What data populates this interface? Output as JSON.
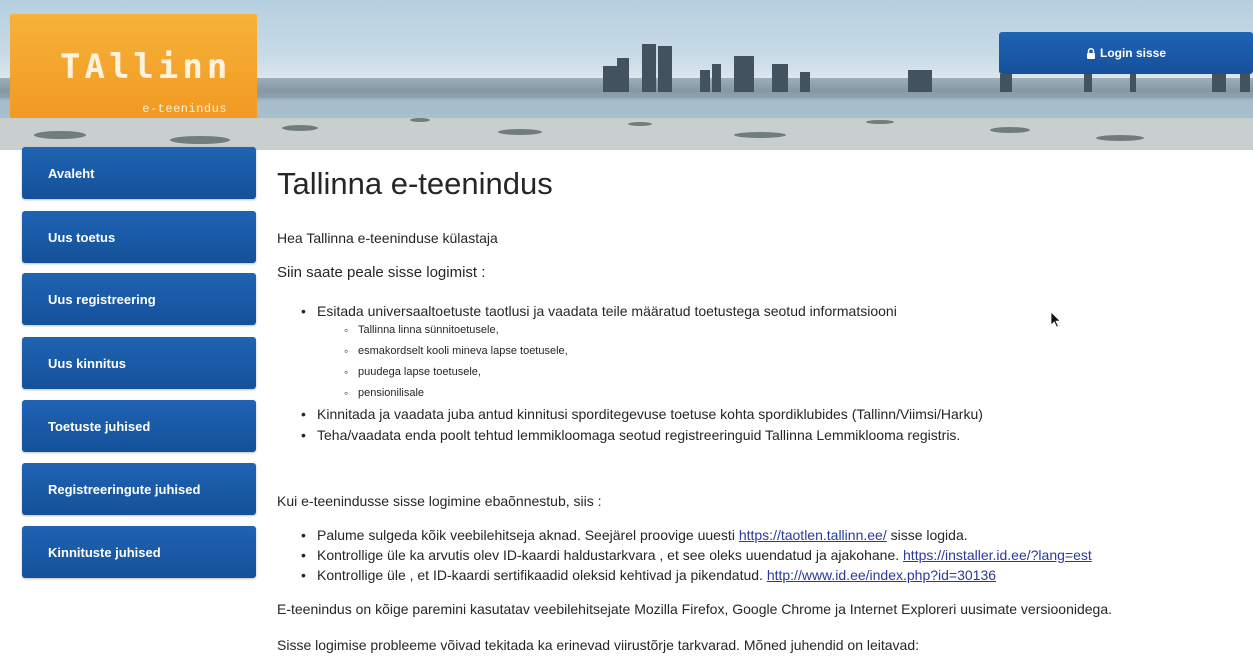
{
  "header": {
    "logo_text": "TAllinn",
    "logo_subtitle": "e-teenindus",
    "login_label": "Login sisse",
    "login_icon": "lock-icon"
  },
  "sidebar": {
    "items": [
      {
        "label": "Avaleht"
      },
      {
        "label": "Uus toetus"
      },
      {
        "label": "Uus registreering"
      },
      {
        "label": "Uus kinnitus"
      },
      {
        "label": "Toetuste juhised"
      },
      {
        "label": "Registreeringute juhised"
      },
      {
        "label": "Kinnituste juhised"
      }
    ]
  },
  "main": {
    "title": "Tallinna e-teenindus",
    "greeting": "Hea Tallinna e-teeninduse külastaja",
    "intro": "Siin saate peale sisse logimist :",
    "services": [
      "Esitada universaaltoetuste taotlusi ja vaadata teile määratud toetustega seotud informatsiooni",
      "Kinnitada ja vaadata juba antud kinnitusi sporditegevuse toetuse kohta spordiklubides (Tallinn/Viimsi/Harku)",
      "Teha/vaadata enda poolt tehtud lemmikloomaga seotud registreeringuid Tallinna Lemmiklooma registris."
    ],
    "subservices": [
      "Tallinna linna sünnitoetusele,",
      "esmakordselt kooli mineva lapse toetusele,",
      "puudega lapse toetusele,",
      "pensionilisale"
    ],
    "trouble_intro": "Kui e-teenindusse sisse logimine ebaõnnestub, siis :",
    "tips": [
      {
        "text": "Palume sulgeda kõik veebilehitseja aknad. Seejärel proovige uuesti ",
        "link": "https://taotlen.tallinn.ee/",
        "after": "  sisse logida."
      },
      {
        "text": "Kontrollige üle ka arvutis olev ID-kaardi haldustarkvara , et see oleks uuendatud ja ajakohane. ",
        "link": "https://installer.id.ee/?lang=est",
        "after": ""
      },
      {
        "text": "Kontrollige üle , et ID-kaardi sertifikaadid oleksid kehtivad ja pikendatud. ",
        "link": "http://www.id.ee/index.php?id=30136",
        "after": ""
      }
    ],
    "browsers_note": "E-teenindus on kõige paremini kasutatav veebilehitsejate Mozilla Firefox, Google Chrome ja Internet Exploreri uusimate versioonidega.",
    "antivirus_note": "Sisse logimise probleeme võivad tekitada ka erinevad viirustõrje tarkvarad. Mõned juhendid on leitavad:"
  },
  "colors": {
    "nav_blue": "#1a5aa8",
    "logo_orange": "#f4a52c",
    "link": "#2a3a9a"
  }
}
